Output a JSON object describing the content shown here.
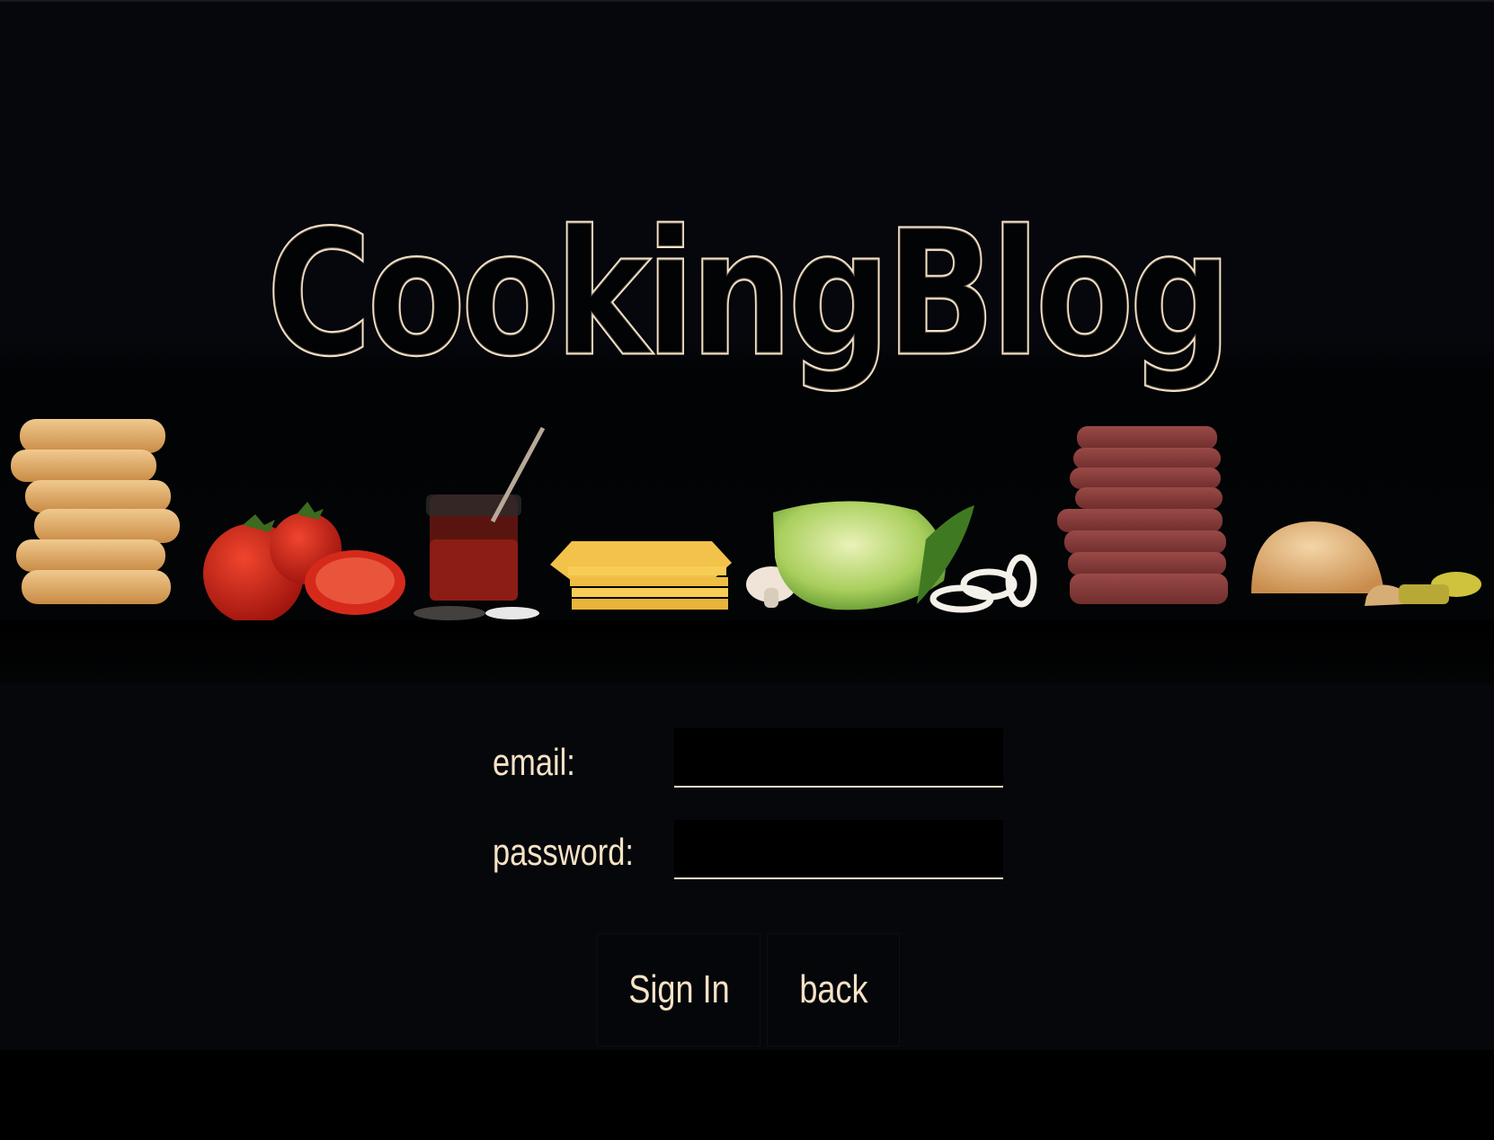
{
  "site": {
    "title": "CookingBlog",
    "banner_image": "burger-ingredients-lineup"
  },
  "colors": {
    "accent": "#f6e2c6",
    "background": "#05070b",
    "field_background": "#000000"
  },
  "form": {
    "email_label": "email:",
    "email_value": "",
    "password_label": "password:",
    "password_value": ""
  },
  "buttons": {
    "sign_in": "Sign In",
    "back": "back"
  }
}
